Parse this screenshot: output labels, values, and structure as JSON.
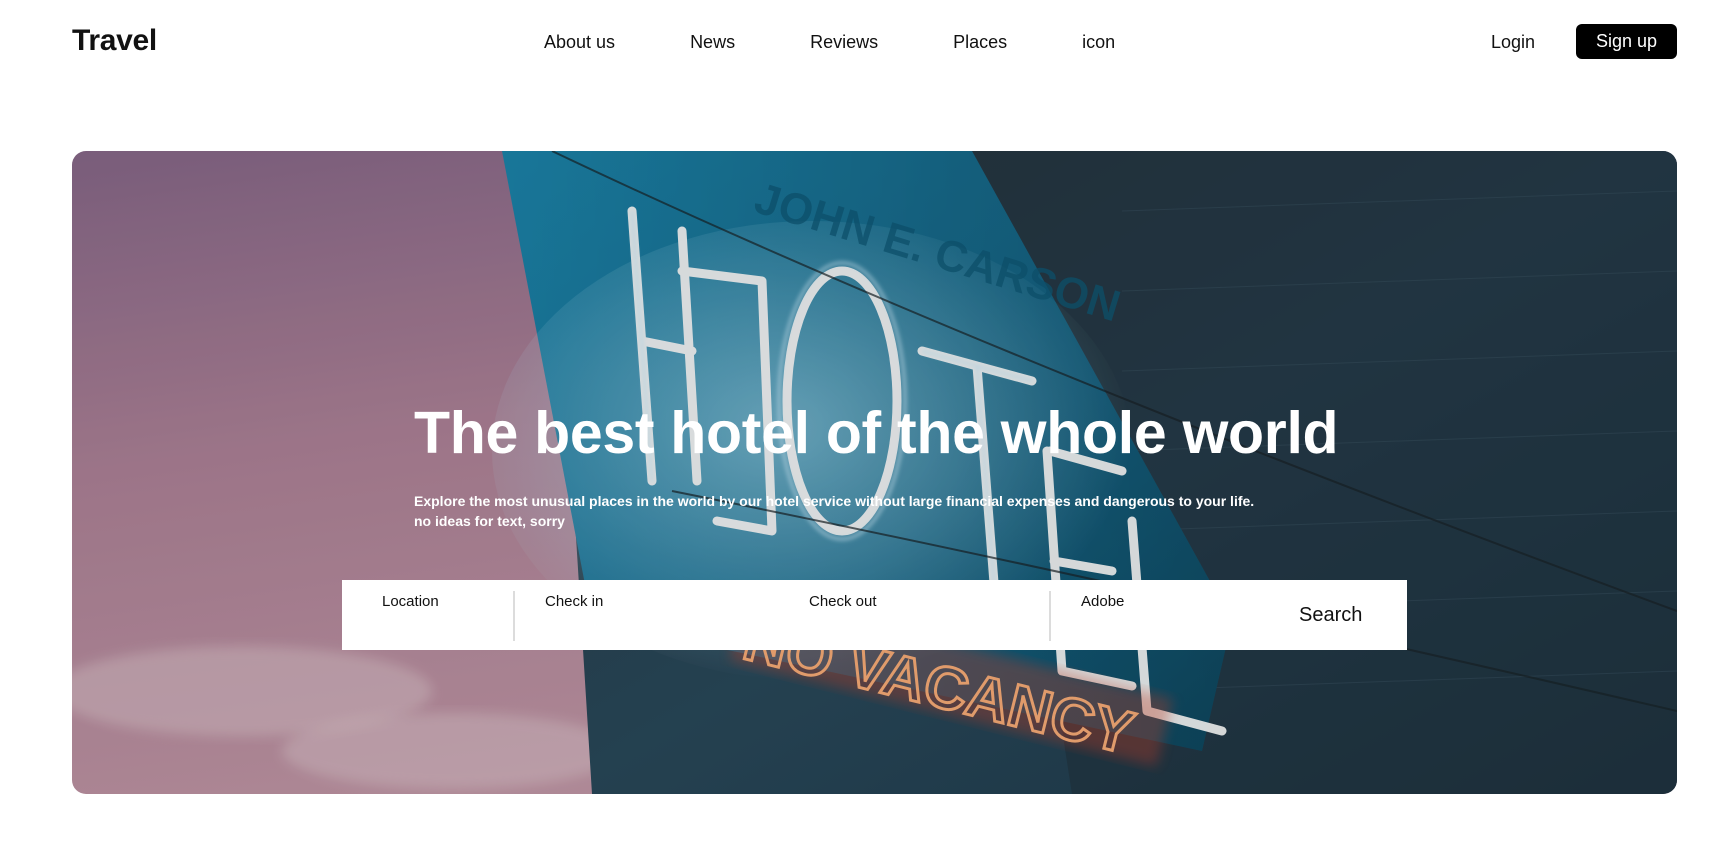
{
  "header": {
    "logo": "Travel",
    "nav": [
      "About us",
      "News",
      "Reviews",
      "Places",
      "icon"
    ],
    "login": "Login",
    "signup": "Sign up"
  },
  "hero": {
    "title": "The best hotel of the whole world",
    "subtitle_line1": "Explore the most unusual places in the world by our hotel service without large financial expenses and dangerous to your life.",
    "subtitle_line2": "no ideas for text, sorry",
    "sign_text": "HOTEL",
    "sign_top_text": "JOHN E. CARSON",
    "sign_bottom_text": "NO VACANCY"
  },
  "search": {
    "location_label": "Location",
    "checkin_label": "Check in",
    "checkout_label": "Check out",
    "adobe_label": "Adobe",
    "button": "Search"
  },
  "colors": {
    "primary": "#000000",
    "background": "#ffffff",
    "neon_blue": "#1e8fb8",
    "neon_red": "#ff5a1f"
  }
}
